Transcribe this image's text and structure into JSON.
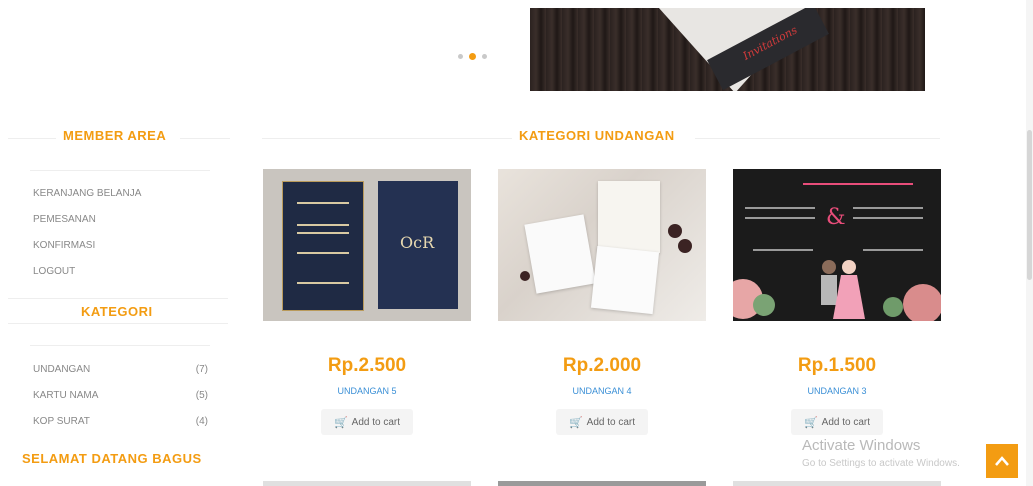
{
  "banner": {
    "brand_script": "Invitations"
  },
  "sidebar": {
    "member_area_title": "MEMBER AREA",
    "member_links": [
      "KERANJANG BELANJA",
      "PEMESANAN",
      "KONFIRMASI",
      "LOGOUT"
    ],
    "kategori_title": "KATEGORI",
    "categories": [
      {
        "name": "UNDANGAN",
        "count": "(7)"
      },
      {
        "name": "KARTU NAMA",
        "count": "(5)"
      },
      {
        "name": "KOP SURAT",
        "count": "(4)"
      }
    ],
    "welcome_text": "SELAMAT DATANG BAGUS"
  },
  "main": {
    "section_title": "KATEGORI UNDANGAN",
    "products": [
      {
        "price": "Rp.2.500",
        "name": "UNDANGAN 5",
        "cart_label": "Add to cart",
        "monogram": "OcR"
      },
      {
        "price": "Rp.2.000",
        "name": "UNDANGAN 4",
        "cart_label": "Add to cart"
      },
      {
        "price": "Rp.1.500",
        "name": "UNDANGAN 3",
        "cart_label": "Add to cart"
      }
    ]
  },
  "windows_watermark": {
    "line1": "Activate Windows",
    "line2": "Go to Settings to activate Windows."
  },
  "icons": {
    "cart": "shopping-cart-icon",
    "scroll_top": "chevron-up-icon"
  },
  "colors": {
    "accent": "#f39c12",
    "link": "#3a8fd6"
  }
}
